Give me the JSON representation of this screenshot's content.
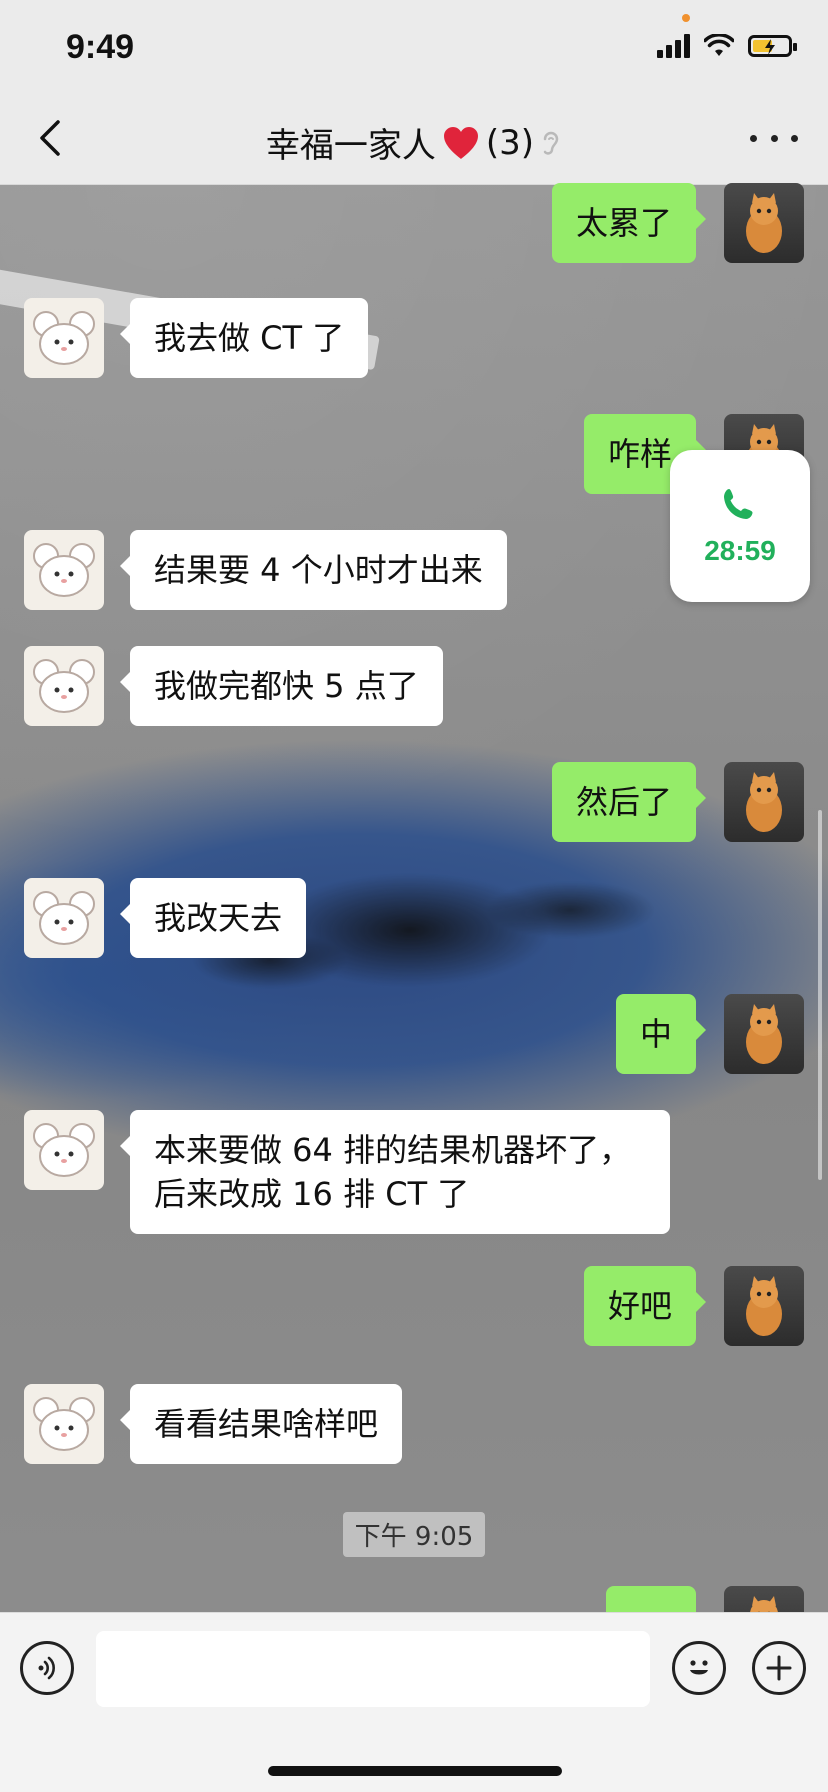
{
  "status_bar": {
    "time": "9:49"
  },
  "nav": {
    "title": "幸福一家人",
    "member_count": "(3)",
    "title_emoji": "red-heart",
    "muted_icon": "ear-icon"
  },
  "messages": [
    {
      "side": "out",
      "text": "太累了"
    },
    {
      "side": "in",
      "text": "我去做 CT 了"
    },
    {
      "side": "out",
      "text": "咋样"
    },
    {
      "side": "in",
      "text": "结果要 4 个小时才出来"
    },
    {
      "side": "in",
      "text": "我做完都快 5 点了"
    },
    {
      "side": "out",
      "text": "然后了"
    },
    {
      "side": "in",
      "text": "我改天去"
    },
    {
      "side": "out",
      "text": "中"
    },
    {
      "side": "in",
      "text": "本来要做 64 排的结果机器坏了，后来改成 16 排 CT 了"
    },
    {
      "side": "out",
      "text": "好吧"
    },
    {
      "side": "in",
      "text": "看看结果啥样吧"
    },
    {
      "side": "out",
      "text": ""
    }
  ],
  "timestamp": "下午 9:05",
  "floating_call": {
    "duration": "28:59",
    "icon": "phone-icon"
  },
  "input_bar": {
    "voice_icon": "voice-icon",
    "emoji_icon": "emoji-icon",
    "plus_icon": "plus-icon",
    "value": ""
  },
  "colors": {
    "outgoing_bubble": "#95ec69",
    "incoming_bubble": "#ffffff",
    "call_green": "#21b05b"
  }
}
